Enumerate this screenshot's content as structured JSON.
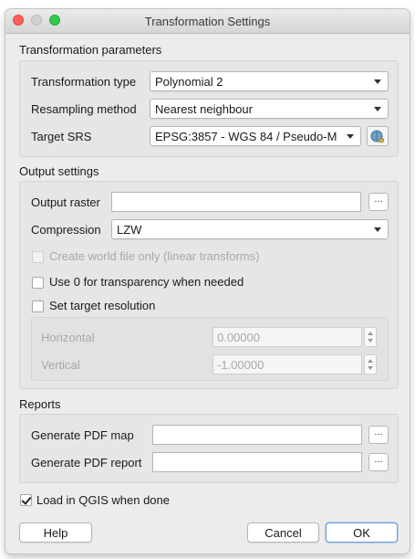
{
  "window": {
    "title": "Transformation Settings"
  },
  "transformation": {
    "section_label": "Transformation parameters",
    "type_label": "Transformation type",
    "type_value": "Polynomial 2",
    "resampling_label": "Resampling method",
    "resampling_value": "Nearest neighbour",
    "srs_label": "Target SRS",
    "srs_value": "EPSG:3857 - WGS 84 / Pseudo-M"
  },
  "output": {
    "section_label": "Output settings",
    "raster_label": "Output raster",
    "raster_value": "",
    "browse_label": "...",
    "compression_label": "Compression",
    "compression_value": "LZW",
    "world_file_label": "Create world file only (linear transforms)",
    "transparency_label": "Use 0 for transparency when needed",
    "target_resolution_label": "Set target resolution",
    "horizontal_label": "Horizontal",
    "horizontal_value": "0.00000",
    "vertical_label": "Vertical",
    "vertical_value": "-1.00000"
  },
  "reports": {
    "section_label": "Reports",
    "pdf_map_label": "Generate PDF map",
    "pdf_map_value": "",
    "pdf_report_label": "Generate PDF report",
    "pdf_report_value": "",
    "browse_label": "..."
  },
  "load_in_qgis": {
    "label": "Load in QGIS when done",
    "checked": true
  },
  "buttons": {
    "help": "Help",
    "cancel": "Cancel",
    "ok": "OK"
  }
}
